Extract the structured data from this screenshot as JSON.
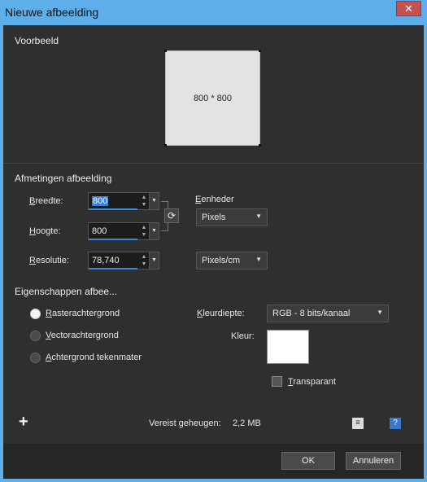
{
  "window": {
    "title": "Nieuwe afbeelding",
    "close_glyph": "✕"
  },
  "preview": {
    "section_title": "Voorbeeld",
    "size_text": "800 * 800"
  },
  "dimensions": {
    "section_title": "Afmetingen afbeelding",
    "width_label_u": "B",
    "width_label_rest": "reedte:",
    "width_value": "800",
    "height_label_u": "H",
    "height_label_rest": "oogte:",
    "height_value": "800",
    "resolution_label_u": "R",
    "resolution_label_rest": "esolutie:",
    "resolution_value": "78,740",
    "units_label_u": "E",
    "units_label_rest": "enheder",
    "units_value": "Pixels",
    "resolution_units_value": "Pixels/cm"
  },
  "properties": {
    "section_title": "Eigenschappen afbee...",
    "options": [
      {
        "u": "R",
        "rest": "asterachtergrond",
        "selected": true
      },
      {
        "u": "V",
        "rest": "ectorachtergrond",
        "selected": false
      },
      {
        "u": "A",
        "rest": "chtergrond tekenmater",
        "selected": false
      }
    ],
    "color_depth_label_u": "K",
    "color_depth_label_rest": "leurdiepte:",
    "color_depth_value": "RGB - 8 bits/kanaal",
    "color_label": "Kleur:",
    "color_value": "#ffffff",
    "transparent_u": "T",
    "transparent_rest": "ransparant"
  },
  "memory": {
    "label": "Vereist geheugen:",
    "value": "2,2 MB"
  },
  "buttons": {
    "ok": "OK",
    "cancel": "Annuleren"
  },
  "colors": {
    "selection": "#3a7fd0",
    "dialog_bg": "#2f2f2f",
    "titlebar": "#5eaee9",
    "close": "#c75050"
  }
}
